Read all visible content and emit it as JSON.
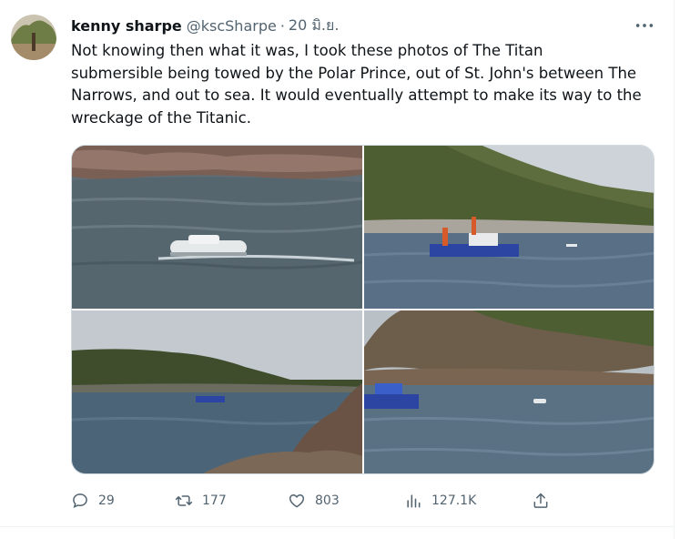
{
  "tweet": {
    "author": {
      "display_name": "kenny sharpe",
      "handle": "@kscSharpe",
      "separator": "·",
      "date": "20 มิ.ย."
    },
    "more_icon": "more-horizontal-icon",
    "text_lines": [
      "Not knowing then what it was, I took these photos of The Titan",
      "submersible being towed by the Polar Prince, out of St. John's between The",
      "Narrows, and out to sea. It would eventually attempt to make its way to the",
      "wreckage of the Titanic."
    ],
    "photos": [
      {
        "alt": "Titan submersible on water near rocky shore"
      },
      {
        "alt": "Polar Prince ship below green hillside"
      },
      {
        "alt": "Ship in harbour under cloudy sky"
      },
      {
        "alt": "Polar Prince towing submersible past cliffs"
      }
    ],
    "actions": {
      "reply": {
        "icon": "reply-icon",
        "count": "29"
      },
      "retweet": {
        "icon": "retweet-icon",
        "count": "177"
      },
      "like": {
        "icon": "heart-icon",
        "count": "803"
      },
      "views": {
        "icon": "views-icon",
        "count": "127.1K"
      },
      "share": {
        "icon": "share-icon"
      }
    }
  }
}
